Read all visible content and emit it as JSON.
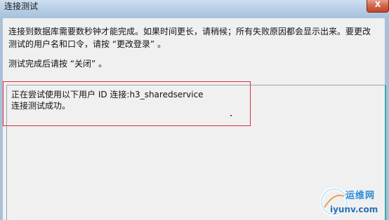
{
  "window": {
    "title": "连接测试",
    "close_label": "X"
  },
  "dialog": {
    "description": "连接到数据库需要数秒钟才能完成。如果时间更长，请稍候；所有失败原因都会显示出来。要更改测试的用户名和口令，请按 “更改登录” 。",
    "hint": "测试完成后请按 “关闭” 。"
  },
  "result": {
    "lines": [
      "正在尝试使用以下用户 ID 连接:h3_sharedservice",
      "连接测试成功。"
    ]
  },
  "watermark": {
    "line1": "运维网",
    "line2": "iyunv.com"
  },
  "colors": {
    "titlebar": "#b9d0e6",
    "close_button": "#c24527",
    "annotation_box": "#e0303a",
    "result_border_right": "#39a9a5"
  }
}
